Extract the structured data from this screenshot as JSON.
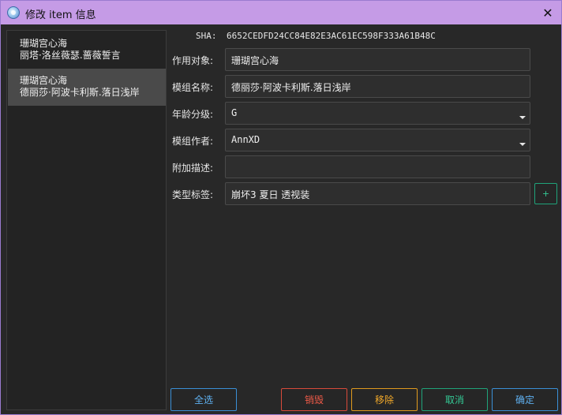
{
  "window": {
    "title": "修改 item 信息",
    "close_symbol": "✕"
  },
  "sidebar": {
    "items": [
      {
        "line1": "珊瑚宫心海",
        "line2": "丽塔·洛丝薇瑟.蔷薇誓言",
        "selected": false
      },
      {
        "line1": "珊瑚宫心海",
        "line2": "德丽莎·阿波卡利斯.落日浅岸",
        "selected": true
      }
    ]
  },
  "form": {
    "sha_label": "SHA:",
    "sha_value": "6652CEDFD24CC84E82E3AC61EC598F333A61B48C",
    "target_label": "作用对象:",
    "target_value": "珊瑚宫心海",
    "mod_name_label": "模组名称:",
    "mod_name_value": "德丽莎·阿波卡利斯.落日浅岸",
    "age_rating_label": "年龄分级:",
    "age_rating_value": "G",
    "author_label": "模组作者:",
    "author_value": "AnnXD",
    "description_label": "附加描述:",
    "description_value": "",
    "tags_label": "类型标签:",
    "tags_value": "崩坏3 夏日 透视装",
    "add_tag_symbol": "+"
  },
  "buttons": {
    "select_all": "全选",
    "destroy": "销毁",
    "remove": "移除",
    "cancel": "取消",
    "confirm": "确定"
  },
  "colors": {
    "titlebar": "#c59be6",
    "background": "#282828",
    "select_all": "#3a8fd6",
    "destroy": "#d84a3a",
    "remove": "#e09a1e",
    "cancel": "#1fa37a",
    "confirm": "#3a8fd6"
  },
  "icons": {
    "app": "snowflake-orb-icon",
    "close": "close-icon",
    "dropdown": "chevron-down-icon"
  }
}
